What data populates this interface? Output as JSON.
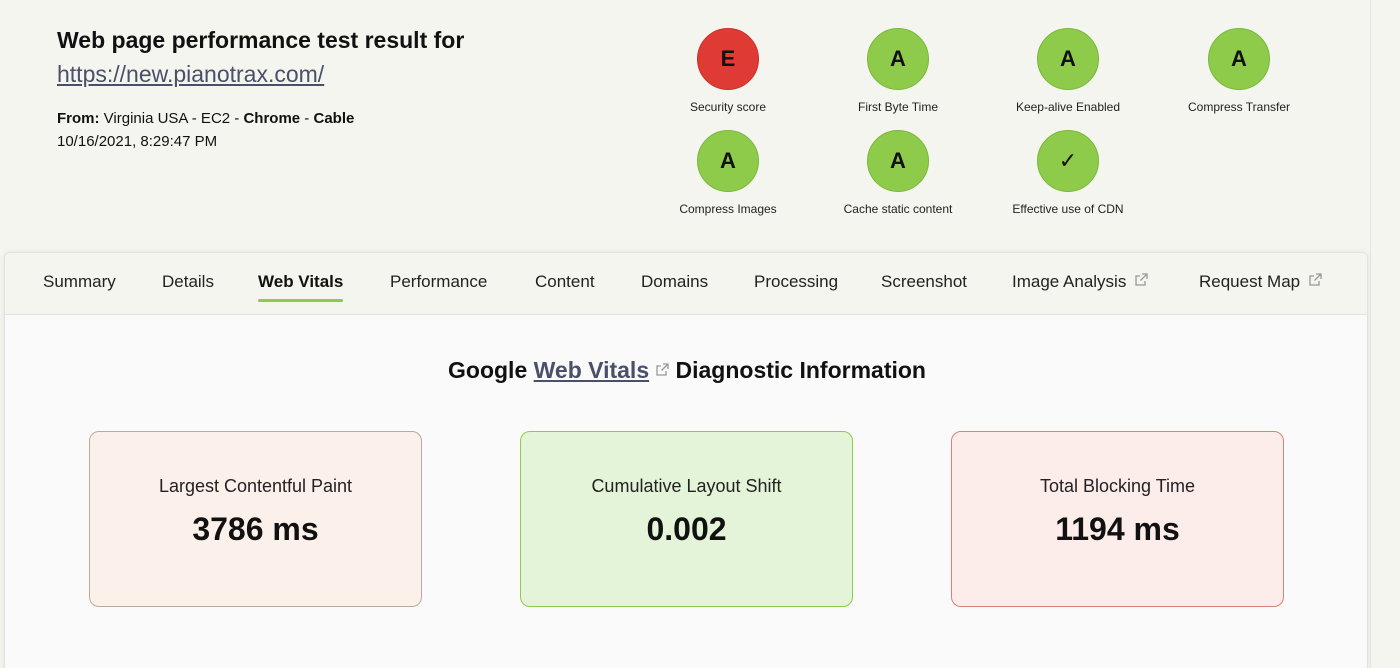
{
  "header": {
    "title": "Web page performance test result for",
    "url": "https://new.pianotrax.com/",
    "from_label": "From:",
    "location": " Virginia USA - EC2 - ",
    "browser": "Chrome",
    "sep": " - ",
    "connection": "Cable",
    "date": "10/16/2021, 8:29:47 PM"
  },
  "grades": [
    {
      "letter": "E",
      "label": "Security score",
      "status": "red"
    },
    {
      "letter": "A",
      "label": "First Byte Time",
      "status": "green"
    },
    {
      "letter": "A",
      "label": "Keep-alive Enabled",
      "status": "green"
    },
    {
      "letter": "A",
      "label": "Compress Transfer",
      "status": "green"
    },
    {
      "letter": "A",
      "label": "Compress Images",
      "status": "green"
    },
    {
      "letter": "A",
      "label": "Cache static content",
      "status": "green"
    },
    {
      "letter": "✓",
      "label": "Effective use of CDN",
      "status": "green"
    }
  ],
  "tabs": [
    {
      "label": "Summary"
    },
    {
      "label": "Details"
    },
    {
      "label": "Web Vitals",
      "active": true
    },
    {
      "label": "Performance"
    },
    {
      "label": "Content"
    },
    {
      "label": "Domains"
    },
    {
      "label": "Processing"
    },
    {
      "label": "Screenshot"
    },
    {
      "label": "Image Analysis",
      "external": true
    },
    {
      "label": "Request Map",
      "external": true
    }
  ],
  "section": {
    "prefix": "Google ",
    "link": "Web Vitals",
    "suffix": " Diagnostic Information"
  },
  "vitals": [
    {
      "name": "Largest Contentful Paint",
      "value": "3786 ms"
    },
    {
      "name": "Cumulative Layout Shift",
      "value": "0.002"
    },
    {
      "name": "Total Blocking Time",
      "value": "1194 ms"
    }
  ],
  "colors": {
    "accent_green": "#8fcb4a",
    "grade_red": "#e03a34",
    "link": "#4a4f6a"
  }
}
